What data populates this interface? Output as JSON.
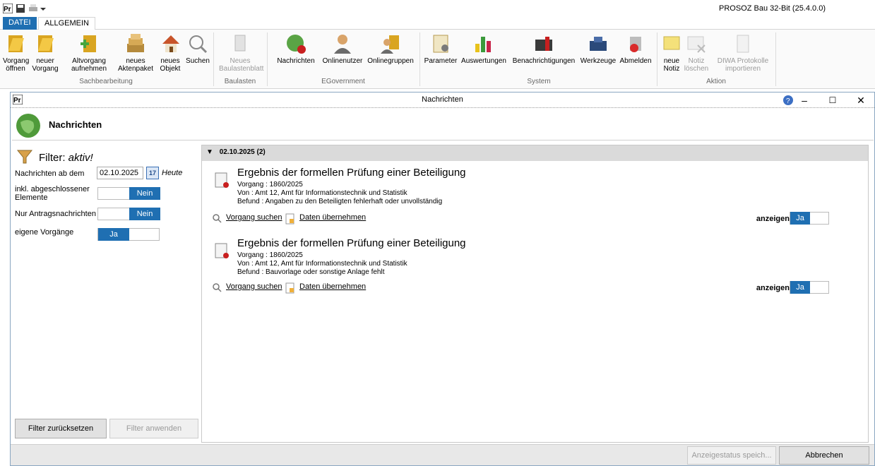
{
  "app": {
    "title": "PROSOZ Bau 32-Bit (25.4.0.0)",
    "tabs": [
      "DATEI",
      "ALLGEMEIN"
    ]
  },
  "ribbon": {
    "sachbearbeitung": {
      "label": "Sachbearbeitung",
      "buttons": [
        "Vorgang öffnen",
        "neuer Vorgang",
        "Altvorgang aufnehmen",
        "neues Aktenpaket",
        "neues Objekt",
        "Suchen"
      ]
    },
    "baulasten": {
      "label": "Baulasten",
      "buttons": [
        "Neues Baulastenblatt"
      ]
    },
    "egovernment": {
      "label": "EGovernment",
      "buttons": [
        "Nachrichten",
        "Onlinenutzer",
        "Onlinegruppen"
      ]
    },
    "system": {
      "label": "System",
      "buttons": [
        "Parameter",
        "Auswertungen",
        "Benachrichtigungen",
        "Werkzeuge",
        "Abmelden"
      ]
    },
    "aktion": {
      "label": "Aktion",
      "buttons": [
        "neue Notiz",
        "Notiz löschen",
        "DIWA Protokolle importieren"
      ]
    }
  },
  "window": {
    "title": "Nachrichten",
    "header": "Nachrichten"
  },
  "filter": {
    "title": "Filter:",
    "status": "aktiv!",
    "date_label": "Nachrichten ab dem",
    "date_value": "02.10.2025",
    "date_calendar": "17",
    "heute": "Heute",
    "closed_label": "inkl. abgeschlossener Elemente",
    "closed_value": "Nein",
    "antrag_label": "Nur Antragsnachrichten",
    "antrag_value": "Nein",
    "eigene_label": "eigene Vorgänge",
    "eigene_value": "Ja",
    "reset_button": "Filter zurücksetzen",
    "apply_button": "Filter anwenden"
  },
  "messages": {
    "group": "02.10.2025 (2)",
    "items": [
      {
        "title": "Ergebnis der formellen Prüfung einer Beteiligung",
        "vorgang": "Vorgang : 1860/2025",
        "von": "Von : Amt 12, Amt für Informationstechnik und Statistik",
        "befund": "Befund : Angaben zu den Beteiligten fehlerhaft oder unvollständig",
        "link_search": "Vorgang suchen",
        "link_data": "Daten übernehmen",
        "anzeigen": "anzeigen",
        "anzeigen_value": "Ja"
      },
      {
        "title": "Ergebnis der formellen Prüfung einer Beteiligung",
        "vorgang": "Vorgang : 1860/2025",
        "von": "Von : Amt 12, Amt für Informationstechnik und Statistik",
        "befund": "Befund : Bauvorlage oder sonstige Anlage fehlt",
        "link_search": "Vorgang suchen",
        "link_data": "Daten übernehmen",
        "anzeigen": "anzeigen",
        "anzeigen_value": "Ja"
      }
    ]
  },
  "footer": {
    "save_button": "Anzeigestatus speich...",
    "cancel_button": "Abbrechen"
  },
  "colors": {
    "accent": "#1f6fb2"
  }
}
